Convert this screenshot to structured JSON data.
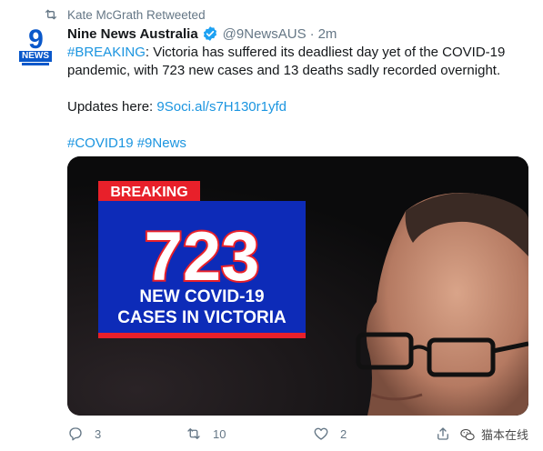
{
  "retweet": {
    "icon": "retweet-icon",
    "text": "Kate McGrath Retweeted"
  },
  "author": {
    "avatar_top": "9",
    "avatar_bottom": "NEWS",
    "name": "Nine News Australia",
    "verified_icon": "verified-badge-icon",
    "handle": "@9NewsAUS",
    "separator": "·",
    "time": "2m"
  },
  "tweet": {
    "hashtag_breaking": "#BREAKING",
    "line1_rest": ": Victoria has suffered its deadliest day yet of the COVID-19 pandemic, with 723 new cases and 13 deaths sadly recorded overnight.",
    "updates_prefix": "Updates here: ",
    "link": "9Soci.al/s7H130r1yfd",
    "hashtag_covid": "#COVID19",
    "hashtag_9news": "#9News"
  },
  "media": {
    "banner": "BREAKING",
    "number": "723",
    "line1": "NEW COVID-19",
    "line2": "CASES IN VICTORIA",
    "colors": {
      "banner_red": "#e8202a",
      "panel_blue": "#0d2bb8",
      "background": "#0b0b0c"
    }
  },
  "actions": {
    "reply": {
      "icon": "reply-icon",
      "count": "3"
    },
    "retweet": {
      "icon": "retweet-icon",
      "count": "10"
    },
    "like": {
      "icon": "heart-icon",
      "count": "2"
    },
    "share": {
      "icon": "share-icon"
    }
  },
  "watermark": {
    "icon": "wechat-icon",
    "text": "猫本在线"
  }
}
